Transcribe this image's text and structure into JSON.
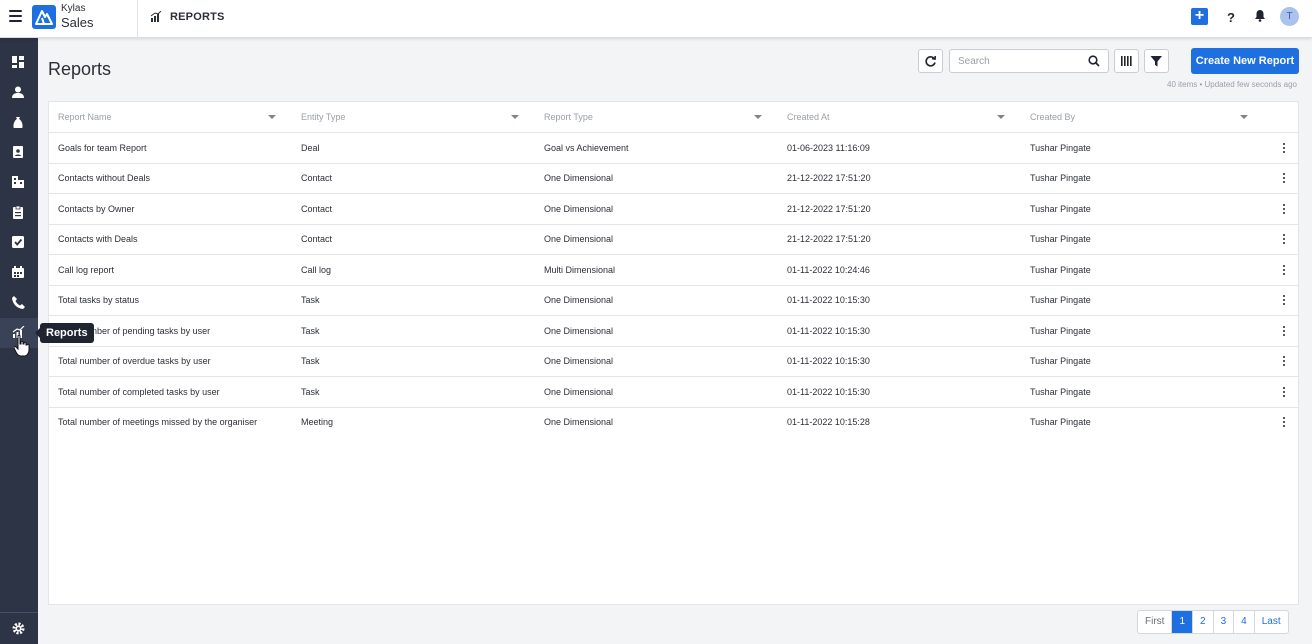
{
  "app": {
    "brand_top": "Kylas",
    "brand_bottom": "Sales",
    "breadcrumb": "REPORTS",
    "avatar_initial": "T",
    "accent": "#1e6fe0"
  },
  "sidebar": {
    "tooltip": "Reports",
    "items": [
      {
        "name": "dashboard"
      },
      {
        "name": "contacts"
      },
      {
        "name": "deals"
      },
      {
        "name": "leads"
      },
      {
        "name": "companies"
      },
      {
        "name": "products"
      },
      {
        "name": "tasks"
      },
      {
        "name": "calendar"
      },
      {
        "name": "calls"
      },
      {
        "name": "reports"
      }
    ]
  },
  "page": {
    "title": "Reports",
    "search_placeholder": "Search",
    "create_button": "Create New Report",
    "meta": "40 items • Updated few seconds ago"
  },
  "table": {
    "columns": [
      "Report Name",
      "Entity Type",
      "Report Type",
      "Created At",
      "Created By"
    ],
    "rows": [
      [
        "Goals for team Report",
        "Deal",
        "Goal vs Achievement",
        "01-06-2023 11:16:09",
        "Tushar Pingate"
      ],
      [
        "Contacts without Deals",
        "Contact",
        "One Dimensional",
        "21-12-2022 17:51:20",
        "Tushar Pingate"
      ],
      [
        "Contacts by Owner",
        "Contact",
        "One Dimensional",
        "21-12-2022 17:51:20",
        "Tushar Pingate"
      ],
      [
        "Contacts with Deals",
        "Contact",
        "One Dimensional",
        "21-12-2022 17:51:20",
        "Tushar Pingate"
      ],
      [
        "Call log report",
        "Call log",
        "Multi Dimensional",
        "01-11-2022 10:24:46",
        "Tushar Pingate"
      ],
      [
        "Total tasks by status",
        "Task",
        "One Dimensional",
        "01-11-2022 10:15:30",
        "Tushar Pingate"
      ],
      [
        "Total number of pending tasks by user",
        "Task",
        "One Dimensional",
        "01-11-2022 10:15:30",
        "Tushar Pingate"
      ],
      [
        "Total number of overdue tasks by user",
        "Task",
        "One Dimensional",
        "01-11-2022 10:15:30",
        "Tushar Pingate"
      ],
      [
        "Total number of completed tasks by user",
        "Task",
        "One Dimensional",
        "01-11-2022 10:15:30",
        "Tushar Pingate"
      ],
      [
        "Total number of meetings missed by the organiser",
        "Meeting",
        "One Dimensional",
        "01-11-2022 10:15:28",
        "Tushar Pingate"
      ]
    ]
  },
  "pagination": {
    "first": "First",
    "pages": [
      "1",
      "2",
      "3",
      "4"
    ],
    "last": "Last",
    "current": "1"
  }
}
